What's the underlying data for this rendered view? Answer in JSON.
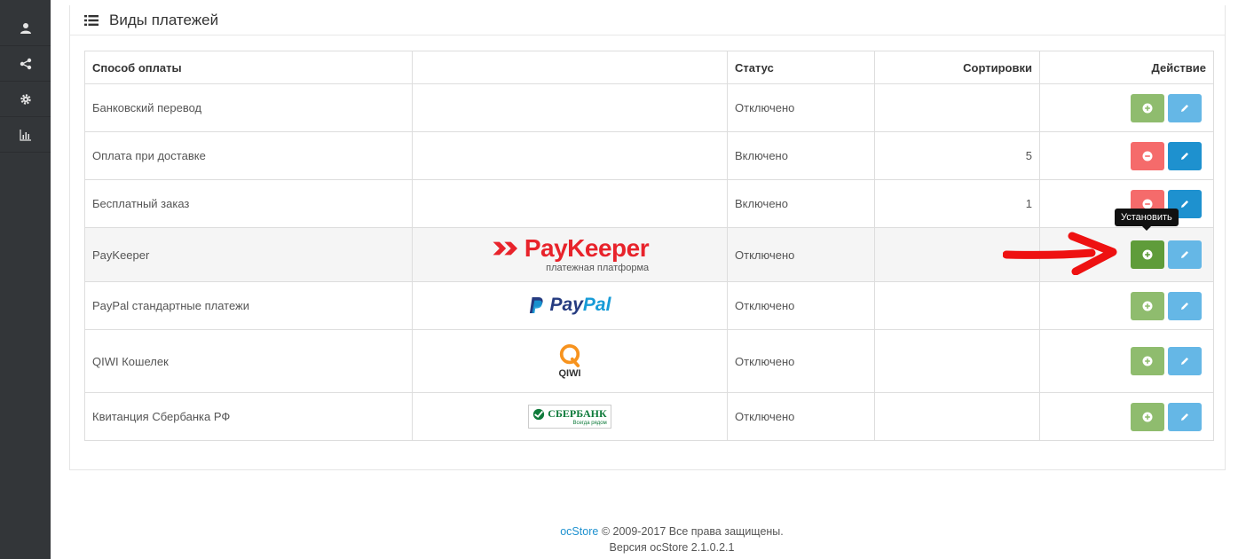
{
  "sidebar": {
    "items": [
      {
        "icon": "user-icon"
      },
      {
        "icon": "share-icon"
      },
      {
        "icon": "gear-icon"
      },
      {
        "icon": "bar-chart-icon"
      }
    ]
  },
  "panel": {
    "title": "Виды платежей"
  },
  "table": {
    "headers": {
      "method": "Способ оплаты",
      "logo": "",
      "status": "Статус",
      "sort": "Сортировки",
      "action": "Действие"
    },
    "rows": [
      {
        "name": "Банковский перевод",
        "status": "Отключено",
        "sort": "",
        "installed": false
      },
      {
        "name": "Оплата при доставке",
        "status": "Включено",
        "sort": "5",
        "installed": true
      },
      {
        "name": "Бесплатный заказ",
        "status": "Включено",
        "sort": "1",
        "installed": true
      },
      {
        "name": "PayKeeper",
        "status": "Отключено",
        "sort": "",
        "installed": false,
        "logo_text": "PayKeeper",
        "logo_sub": "платежная платформа"
      },
      {
        "name": "PayPal стандартные платежи",
        "status": "Отключено",
        "sort": "",
        "installed": false,
        "logo_text_a": "Pay",
        "logo_text_b": "Pal"
      },
      {
        "name": "QIWI Кошелек",
        "status": "Отключено",
        "sort": "",
        "installed": false,
        "logo_text": "QIWI"
      },
      {
        "name": "Квитанция Сбербанка РФ",
        "status": "Отключено",
        "sort": "",
        "installed": false,
        "logo_text": "СБЕРБАНК",
        "logo_sub": "Всегда рядом"
      }
    ]
  },
  "tooltip": {
    "install": "Установить"
  },
  "colors": {
    "sidebar_bg": "#333639",
    "install_green": "#8fbc6e",
    "install_green_hover": "#5f9c3a",
    "uninstall_red": "#f56b6b",
    "edit_blue": "#1e91cf",
    "edit_blue_light": "#65b7e6",
    "arrow_red": "#ee1111"
  },
  "footer": {
    "brand": "ocStore",
    "copyright": "© 2009-2017 Все права защищены.",
    "version": "Версия ocStore 2.1.0.2.1"
  }
}
